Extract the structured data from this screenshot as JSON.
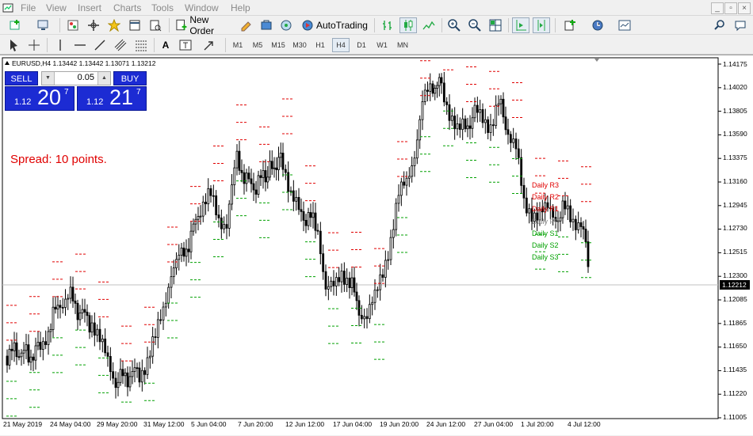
{
  "menu": {
    "items": [
      "File",
      "View",
      "Insert",
      "Charts",
      "Tools",
      "Window",
      "Help"
    ]
  },
  "toolbar": {
    "new_order_label": "New Order",
    "autotrading_label": "AutoTrading",
    "timeframes": [
      "M1",
      "M5",
      "M15",
      "M30",
      "H1",
      "H4",
      "D1",
      "W1",
      "MN"
    ],
    "active_timeframe": "H4"
  },
  "chart": {
    "title": "EURUSD,H4  1.13442 1.13442 1.13071 1.13212",
    "spread_text": "Spread: 10 points.",
    "current_price": "1.12212",
    "price_labels": [
      "1.14175",
      "1.14020",
      "1.13805",
      "1.13590",
      "1.13375",
      "1.13160",
      "1.12945",
      "1.12730",
      "1.12515",
      "1.12300",
      "1.12085",
      "1.11865",
      "1.11650",
      "1.11435",
      "1.11220",
      "1.11005"
    ],
    "time_labels": [
      "21 May 2019",
      "24 May 04:00",
      "29 May 20:00",
      "31 May 12:00",
      "5 Jun 04:00",
      "7 Jun 20:00",
      "12 Jun 12:00",
      "17 Jun 04:00",
      "19 Jun 20:00",
      "24 Jun 12:00",
      "27 Jun 04:00",
      "1 Jul 20:00",
      "4 Jul 12:00"
    ]
  },
  "trade_panel": {
    "sell_label": "SELL",
    "buy_label": "BUY",
    "lot_value": "0.05",
    "bid_small": "1.12",
    "bid_big": "20",
    "bid_sup": "7",
    "ask_small": "1.12",
    "ask_big": "21",
    "ask_sup": "7"
  },
  "pivots": {
    "labels": [
      {
        "text": "Daily R3",
        "color": "#e00000"
      },
      {
        "text": "Daily R2",
        "color": "#e00000"
      },
      {
        "text": "Daily R1",
        "color": "#e00000"
      },
      {
        "text": "Daily PP",
        "color": "#808080"
      },
      {
        "text": "Daily S1",
        "color": "#00a000"
      },
      {
        "text": "Daily S2",
        "color": "#00a000"
      },
      {
        "text": "Daily S3",
        "color": "#00a000"
      }
    ]
  },
  "colors": {
    "resistance": "#e00000",
    "support": "#00a000",
    "panel_blue": "#1c2bd3",
    "candle": "#000000"
  }
}
